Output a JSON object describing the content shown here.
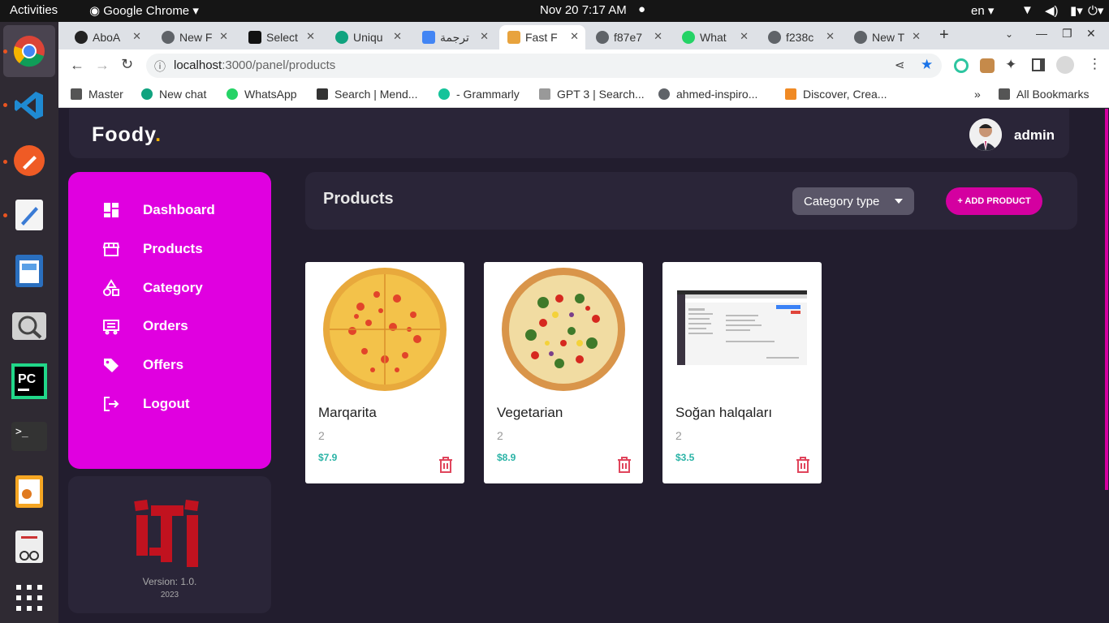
{
  "system": {
    "activities": "Activities",
    "app": "Google Chrome",
    "clock": "Nov 20  7:17 AM",
    "lang": "en"
  },
  "tabs": [
    {
      "label": "AboA"
    },
    {
      "label": "New F"
    },
    {
      "label": "Select"
    },
    {
      "label": "Uniqu"
    },
    {
      "label": "ترجمة"
    },
    {
      "label": "Fast F"
    },
    {
      "label": "f87e7"
    },
    {
      "label": "What"
    },
    {
      "label": "f238c"
    },
    {
      "label": "New T"
    }
  ],
  "url": {
    "host": "localhost",
    "path": ":3000/panel/products"
  },
  "bookmarks": [
    {
      "label": "Master"
    },
    {
      "label": "New chat"
    },
    {
      "label": "WhatsApp"
    },
    {
      "label": "Search | Mend..."
    },
    {
      "label": "- Grammarly"
    },
    {
      "label": "GPT 3 | Search..."
    },
    {
      "label": "ahmed-inspiro..."
    },
    {
      "label": "Discover, Crea..."
    }
  ],
  "bookmarks_more": "»",
  "bookmarks_all": "All Bookmarks",
  "header": {
    "brand": "Foody",
    "brand_dot": ".",
    "user": "admin"
  },
  "sidebar": {
    "items": [
      {
        "label": "Dashboard",
        "icon": "dashboard-icon"
      },
      {
        "label": "Products",
        "icon": "store-icon"
      },
      {
        "label": "Category",
        "icon": "shapes-icon"
      },
      {
        "label": "Orders",
        "icon": "cart-icon"
      },
      {
        "label": "Offers",
        "icon": "tag-icon"
      },
      {
        "label": "Logout",
        "icon": "logout-icon"
      }
    ]
  },
  "footer": {
    "version": "Version: 1.0.",
    "year": "2023"
  },
  "toolbar": {
    "title": "Products",
    "category_select": "Category type",
    "add_label": "+ ADD PRODUCT"
  },
  "products": [
    {
      "name": "Marqarita",
      "qty": "2",
      "price": "$7.9"
    },
    {
      "name": "Vegetarian",
      "qty": "2",
      "price": "$8.9"
    },
    {
      "name": "Soğan halqaları",
      "qty": "2",
      "price": "$3.5"
    }
  ],
  "colors": {
    "accent": "#e000e0",
    "button": "#d400a0",
    "price": "#2ab3a6",
    "bg": "#221d2e",
    "panel": "#2a2538",
    "brand_dot": "#f5b400"
  }
}
